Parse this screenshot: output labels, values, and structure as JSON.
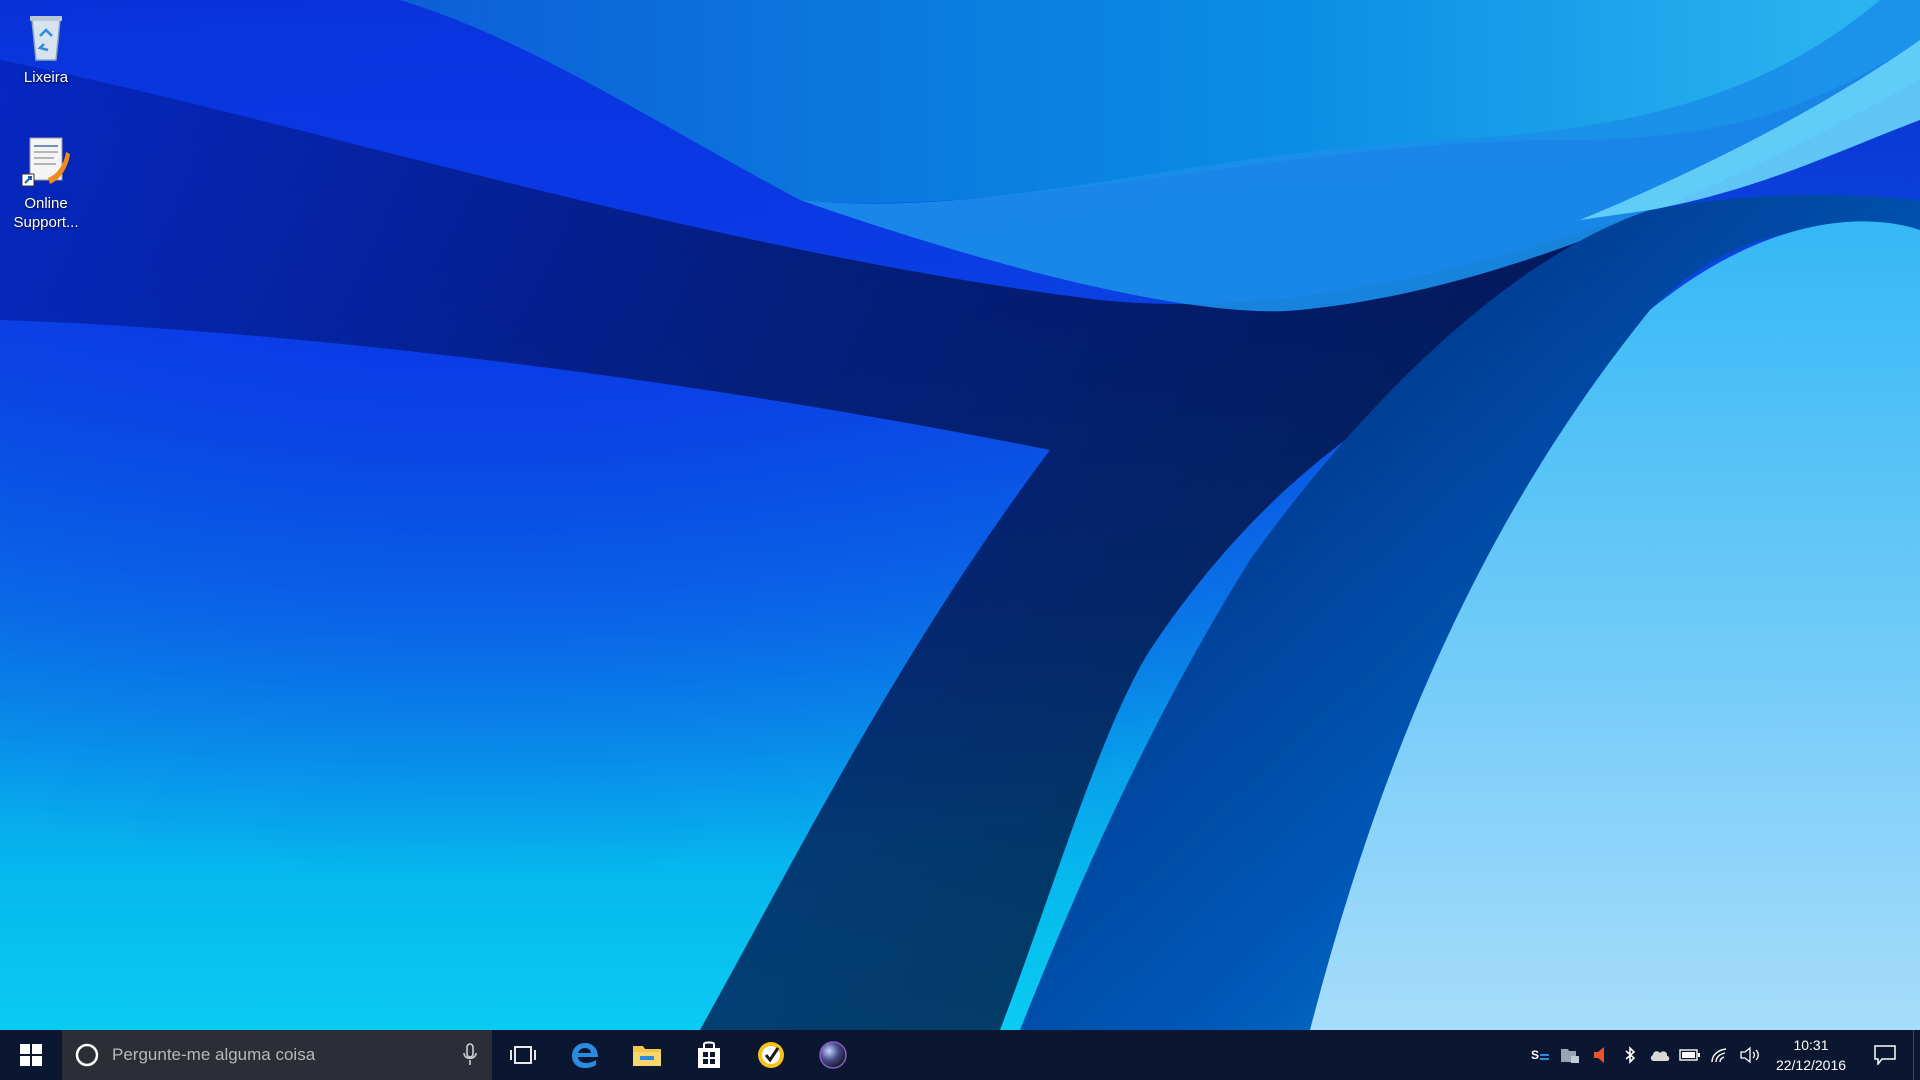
{
  "desktop": {
    "icons": [
      {
        "label": "Lixeira",
        "icon": "recycle-bin-icon"
      },
      {
        "label": "Online\nSupport...",
        "icon": "online-support-icon"
      }
    ]
  },
  "taskbar": {
    "search": {
      "placeholder": "Pergunte-me alguma coisa"
    },
    "pinned": [
      {
        "icon": "task-view-icon"
      },
      {
        "icon": "edge-icon"
      },
      {
        "icon": "file-explorer-icon"
      },
      {
        "icon": "store-icon"
      },
      {
        "icon": "norton-icon"
      },
      {
        "icon": "app-sphere-icon"
      }
    ],
    "tray": [
      {
        "icon": "skype-icon"
      },
      {
        "icon": "lock-folder-icon"
      },
      {
        "icon": "speaker-alert-icon"
      },
      {
        "icon": "bluetooth-icon"
      },
      {
        "icon": "onedrive-icon"
      },
      {
        "icon": "battery-icon"
      },
      {
        "icon": "wifi-icon"
      },
      {
        "icon": "volume-icon"
      }
    ],
    "clock": {
      "time": "10:31",
      "date": "22/12/2016"
    }
  },
  "colors": {
    "taskbar": "#0b1630",
    "search_box": "#2b2e36",
    "accent": "#0a7fe6"
  }
}
